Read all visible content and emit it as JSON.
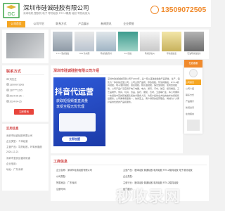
{
  "header": {
    "company": "深圳市硅诚硅胶有限公司",
    "tagline": "深圳电机 塑胶机 电子 导热硅胶 RTV-2模具 硅胶 导热硅胶片",
    "phone": "13509072505"
  },
  "nav": [
    "公司首页",
    "公司介绍",
    "联系方式",
    "产品展示",
    "新闻资讯",
    "企业荣誉",
    "在线留言"
  ],
  "products": [
    "1.5-2 液态硅胶",
    "TPE 防水圈",
    "导热硅胶垫片",
    "8:2 硅胶",
    "导热矽胶(1)",
    "导热硅胶套",
    "石油导热硅胶片",
    "导热硅胶片",
    "3 LED导热硅胶"
  ],
  "contact": {
    "title": "联系方式",
    "rows": [
      "刘先生",
      "13509072505",
      "139****1205",
      "2024-05-25 --",
      "2024-04-25"
    ],
    "button": "立即联系"
  },
  "intro": {
    "title": "深圳市硅诚硅胶有限公司介绍",
    "banner_title": "抖音代运营",
    "banner_sub1": "获取短视频垂直流量",
    "banner_sub2": "享受全程无忧代理",
    "banner_btn": "立即加盟",
    "paragraph": "深圳市硅诚硅胶有限公司于2003年，是一家从事硅胶硅胶产品研发，生产，销售为一体的综合型公司。公司主营产品有：导热硅胶，环氧树脂胶，RTV-2模具硅胶，电子灌封硅胶，液态硅胶，耐高温硅胶，缩合型硅胶，加成型硅胶等。公司产品广泛应用于电子电器，电力，通讯，汽车，航空，模具制造，工艺品制作，家具，玩具，食品，医疗，服装，石材，五金等行业，本公司拥有一支经验丰富的研发团队和技术服务人员，为客户提供全方位的技术支持和售后服务。公司秉承质量第一，信誉至上，客户满意的经营理念，竭诚为广大客户提供优质的产品和服务。"
  },
  "left2": {
    "title": "实用信息",
    "rows": [
      "深圳市硅诚硅胶有限公司",
      "企业类型：个体经营",
      "主营产品：导热硅胶，环氧树脂胶",
      "2024-12-21",
      "深圳市宝安区福永街道",
      "企业信用：",
      "地址：广东深圳"
    ]
  },
  "business": {
    "title": "工商信息",
    "left": [
      "企业名称：深圳市硅诚硅胶有限公司",
      "公司类型：",
      "所属地区：广东深圳",
      "注册时间："
    ],
    "right": [
      "主营产品：液体硅胶 普通硅胶 机用硅胶 RTV-2模具硅胶 电子灌封硅胶",
      "企业类型：",
      "主营行业：液体硅胶 普通硅胶 机用硅胶 RTV-2模具硅胶",
      "经营模式："
    ]
  },
  "float": {
    "head": "在线客服",
    "items": [
      "公司首页",
      "公司介绍",
      "联系方式",
      "产品展示",
      "新闻资讯",
      "在线留言"
    ]
  },
  "watermark": "秒收录网",
  "colors": {
    "accent": "#f5a623",
    "phone": "#f08a2c",
    "title": "#d14848",
    "banner": "#2b4cc4"
  }
}
